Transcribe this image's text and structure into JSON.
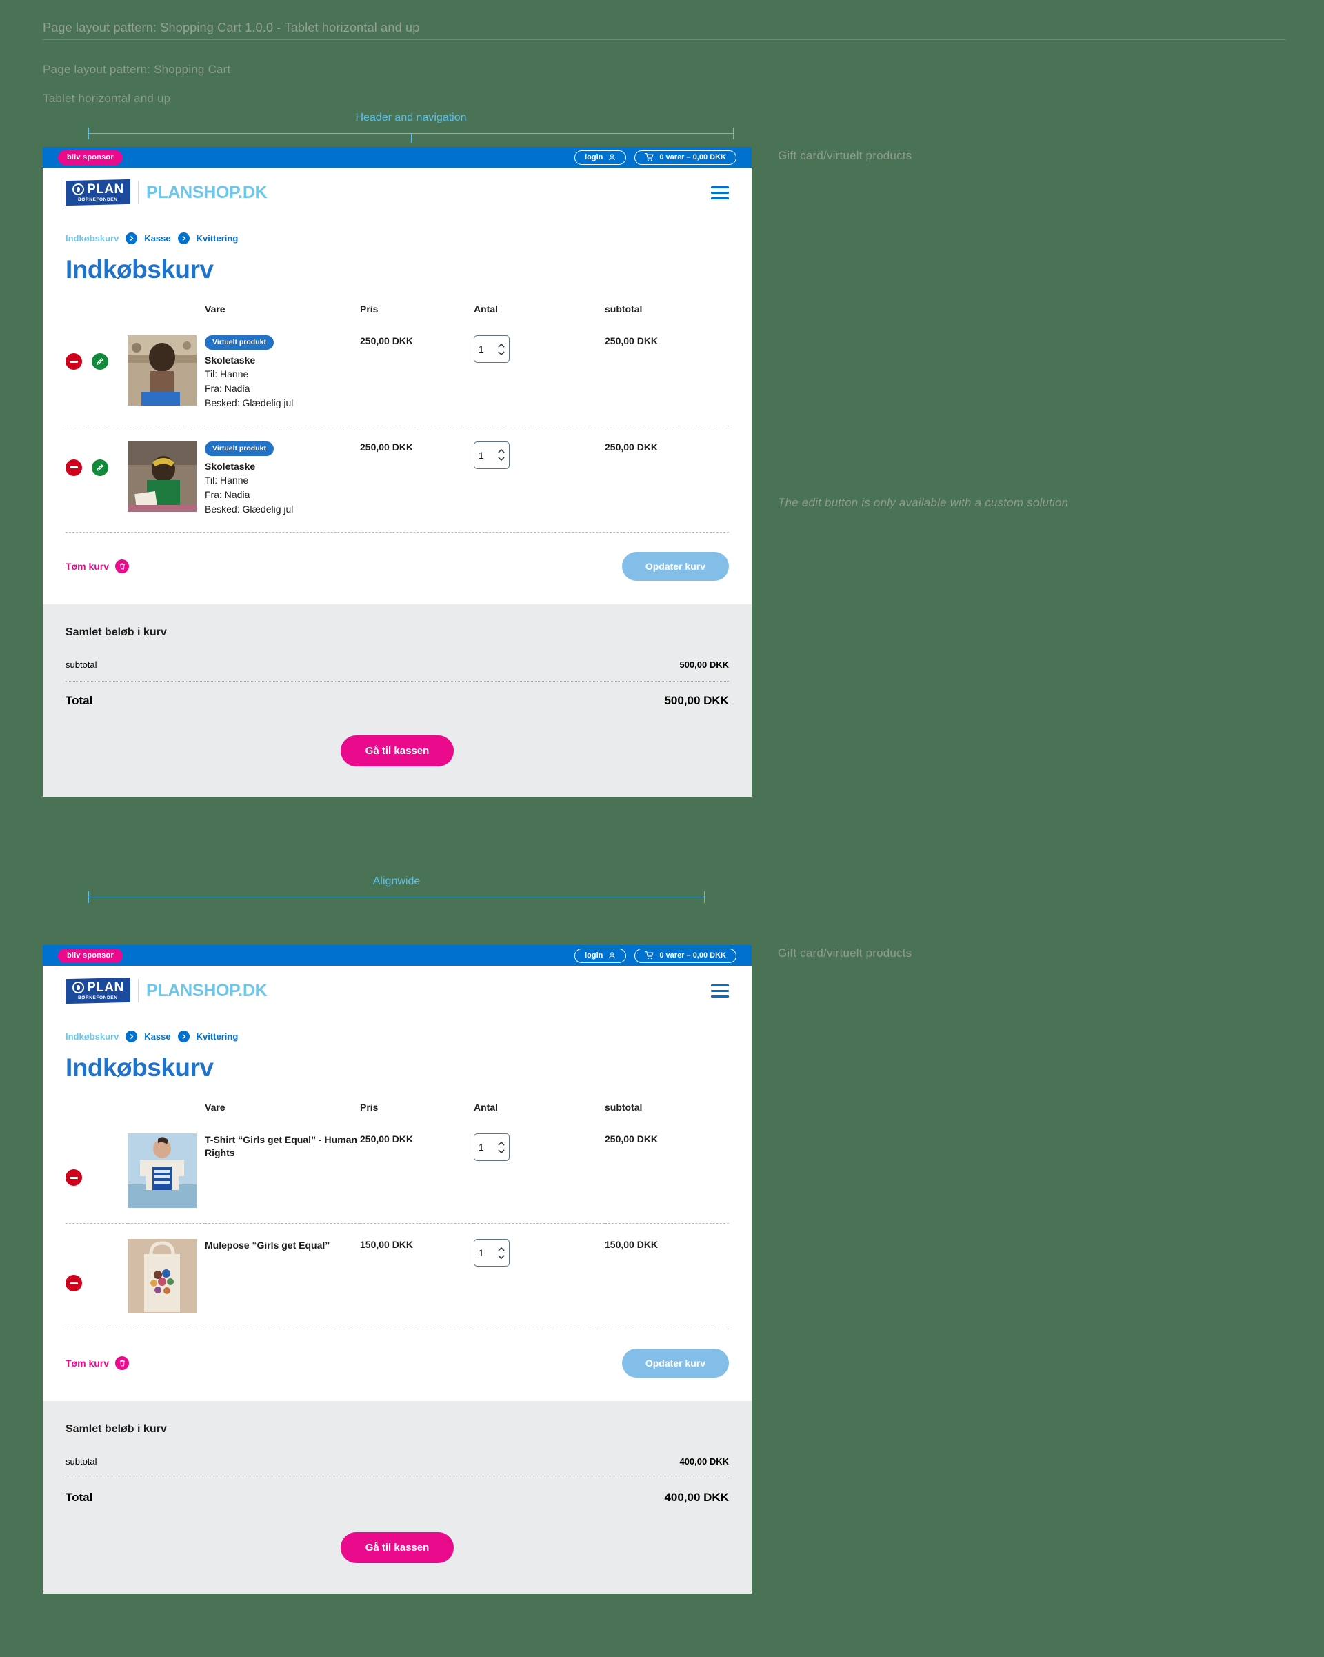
{
  "annotations": {
    "header_title": "Page layout pattern: Shopping Cart 1.0.0 - Tablet horizontal and up",
    "pattern_label": "Page layout pattern: Shopping Cart",
    "breakpoint_label": "Tablet horizontal and up",
    "measure_header": "Header and navigation",
    "measure_alignwide": "Alignwide",
    "note_giftcard": "Gift card/virtuelt products",
    "note_editbutton": "The edit button is only available with a custom solution"
  },
  "colors": {
    "brand_blue": "#0071ce",
    "brand_pink": "#ea0a8c",
    "light_blue": "#6ec6e8",
    "update_blue": "#82bee8",
    "remove_red": "#d0021b",
    "edit_green": "#128a3c",
    "totals_bg": "#eaebec",
    "canvas_green": "#4a7254",
    "annotation_grey": "#8d9c8e",
    "measure_cyan": "#5bc0e8"
  },
  "header": {
    "sponsor_label": "bliv sponsor",
    "login_label": "login",
    "login_icon": "user-icon",
    "cart_icon": "shopping-cart-icon",
    "cart_summary": "0 varer – 0,00 DKK",
    "logo_mark_text": "PLAN",
    "logo_mark_sub": "BØRNEFONDEN",
    "logo_text": "PLANSHOP.DK",
    "menu_icon": "hamburger-menu-icon"
  },
  "breadcrumb": {
    "items": [
      {
        "label": "Indkøbskurv",
        "current": true
      },
      {
        "label": "Kasse",
        "current": false
      },
      {
        "label": "Kvittering",
        "current": false
      }
    ],
    "separator_icon": "chevron-right-circle-icon"
  },
  "page_title": "Indkøbskurv",
  "table_headers": {
    "vare": "Vare",
    "pris": "Pris",
    "antal": "Antal",
    "subtotal": "subtotal"
  },
  "actions": {
    "empty_cart_label": "Tøm kurv",
    "empty_cart_icon": "trash-icon",
    "update_cart_label": "Opdater kurv",
    "remove_icon": "remove-minus-icon",
    "edit_icon": "pencil-edit-icon",
    "qty_up_icon": "chevron-up-icon",
    "qty_down_icon": "chevron-down-icon"
  },
  "totals_labels": {
    "heading": "Samlet beløb i kurv",
    "subtotal": "subtotal",
    "total": "Total",
    "checkout": "Gå til kassen"
  },
  "carts": [
    {
      "id": "virtual-products-cart",
      "items": [
        {
          "badge": "Virtuelt produkt",
          "name": "Skoletaske",
          "meta": [
            "Til: Hanne",
            "Fra: Nadia",
            "Besked: Glædelig jul"
          ],
          "price": "250,00 DKK",
          "qty": "1",
          "subtotal": "250,00 DKK",
          "image_alt": "boy-with-blue-school-bag-photo",
          "has_edit": true
        },
        {
          "badge": "Virtuelt produkt",
          "name": "Skoletaske",
          "meta": [
            "Til: Hanne",
            "Fra: Nadia",
            "Besked: Glædelig jul"
          ],
          "price": "250,00 DKK",
          "qty": "1",
          "subtotal": "250,00 DKK",
          "image_alt": "girl-in-green-shirt-reading-photo",
          "has_edit": true
        }
      ],
      "subtotal": "500,00 DKK",
      "total": "500,00 DKK"
    },
    {
      "id": "physical-products-cart",
      "items": [
        {
          "badge": "",
          "name": "T-Shirt “Girls get Equal” - Human Rights",
          "meta": [],
          "price": "250,00 DKK",
          "qty": "1",
          "subtotal": "250,00 DKK",
          "image_alt": "person-wearing-blue-print-tshirt-photo",
          "has_edit": false
        },
        {
          "badge": "",
          "name": "Mulepose “Girls get Equal”",
          "meta": [],
          "price": "150,00 DKK",
          "qty": "1",
          "subtotal": "150,00 DKK",
          "image_alt": "tote-bag-with-people-print-photo",
          "has_edit": false
        }
      ],
      "subtotal": "400,00 DKK",
      "total": "400,00 DKK"
    }
  ]
}
